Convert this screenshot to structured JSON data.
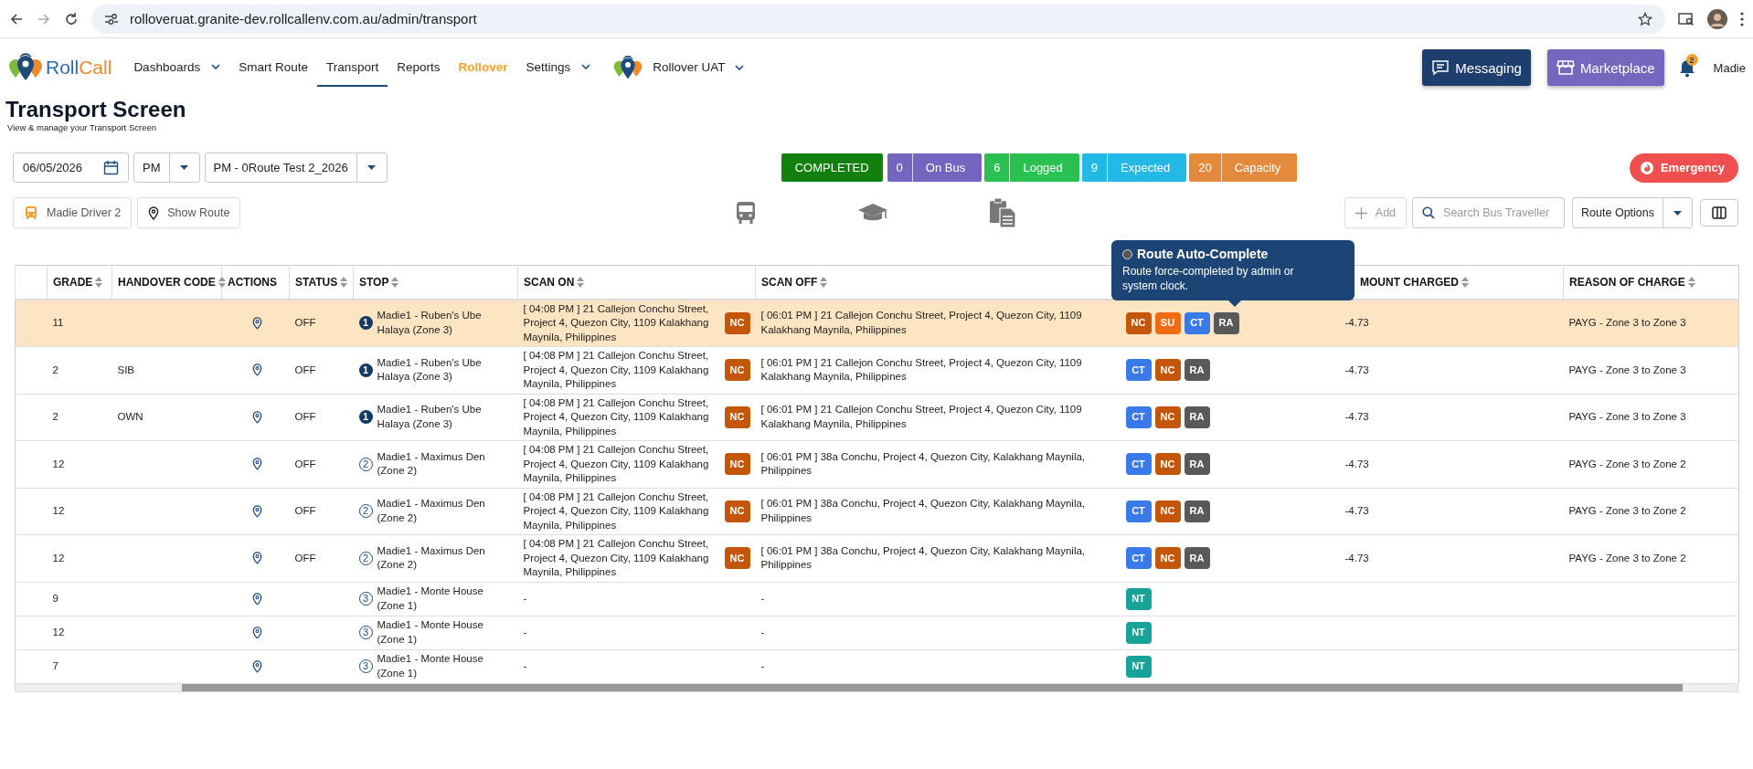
{
  "browser": {
    "url": "rolloveruat.granite-dev.rollcallenv.com.au/admin/transport"
  },
  "nav": {
    "logo": {
      "first": "Roll",
      "second": "Call"
    },
    "items": [
      {
        "label": "Dashboards",
        "menu": true,
        "selected": false,
        "emphasized": false
      },
      {
        "label": "Smart Route",
        "menu": false,
        "selected": false,
        "emphasized": false
      },
      {
        "label": "Transport",
        "menu": false,
        "selected": true,
        "emphasized": false
      },
      {
        "label": "Reports",
        "menu": false,
        "selected": false,
        "emphasized": false
      },
      {
        "label": "Rollover",
        "menu": false,
        "selected": false,
        "emphasized": true
      },
      {
        "label": "Settings",
        "menu": true,
        "selected": false,
        "emphasized": false
      }
    ],
    "org": "Rollover UAT",
    "messaging": "Messaging",
    "marketplace": "Marketplace",
    "notifications": "2",
    "user": "Madie"
  },
  "page": {
    "title": "Transport Screen",
    "subtitle": "View & manage your Transport Screen"
  },
  "filters": {
    "date": "06/05/2026",
    "period": "PM",
    "route": "PM - 0Route Test 2_2026"
  },
  "status_summary": {
    "state": "COMPLETED",
    "counters": [
      {
        "count": "0",
        "label": "On Bus",
        "color": "#7466c0"
      },
      {
        "count": "6",
        "label": "Logged",
        "color": "#2ac152"
      },
      {
        "count": "9",
        "label": "Expected",
        "color": "#24b8e6"
      },
      {
        "count": "20",
        "label": "Capacity",
        "color": "#e48a3c"
      }
    ]
  },
  "emergency": "Emergency",
  "toolbar": {
    "driver": "Madie Driver 2",
    "show_route": "Show Route",
    "add": "Add",
    "add_disabled": true,
    "search_placeholder": "Search Bus Traveller",
    "route_options": "Route Options"
  },
  "table": {
    "columns": [
      {
        "label": "GRADE",
        "sortable": true
      },
      {
        "label": "HANDOVER CODE",
        "sortable": true
      },
      {
        "label": "ACTIONS",
        "sortable": false
      },
      {
        "label": "STATUS",
        "sortable": true
      },
      {
        "label": "STOP",
        "sortable": true
      },
      {
        "label": "SCAN ON",
        "sortable": true
      },
      {
        "label": "SCAN OFF",
        "sortable": true
      },
      {
        "label": "MOUNT CHARGED",
        "sortable": true
      },
      {
        "label": "REASON OF CHARGE",
        "sortable": true
      }
    ],
    "rows": [
      {
        "selected": true,
        "grade": "11",
        "handover_code": "",
        "status": "OFF",
        "stop": {
          "number": "1",
          "name": "Madie1 - Ruben's Ube Halaya (Zone 3)",
          "filled": true
        },
        "scan_on": {
          "text": "[ 04:08 PM ] 21 Callejon Conchu Street, Project 4, Quezon City, 1109 Kalakhang Maynila, Philippines",
          "badge": {
            "code": "NC",
            "color": "#c4560a"
          }
        },
        "scan_off": "[ 06:01 PM ] 21 Callejon Conchu Street, Project 4, Quezon City, 1109 Kalakhang Maynila, Philippines",
        "tags": [
          {
            "code": "NC",
            "color": "#c4560a"
          },
          {
            "code": "SU",
            "color": "#f26b12"
          },
          {
            "code": "CT",
            "color": "#3a7ae8"
          },
          {
            "code": "RA",
            "color": "#595959"
          }
        ],
        "amount": "-4.73",
        "reason": "PAYG - Zone 3 to Zone 3"
      },
      {
        "selected": false,
        "grade": "2",
        "handover_code": "SIB",
        "status": "OFF",
        "stop": {
          "number": "1",
          "name": "Madie1 - Ruben's Ube Halaya (Zone 3)",
          "filled": true
        },
        "scan_on": {
          "text": "[ 04:08 PM ] 21 Callejon Conchu Street, Project 4, Quezon City, 1109 Kalakhang Maynila, Philippines",
          "badge": {
            "code": "NC",
            "color": "#c4560a"
          }
        },
        "scan_off": "[ 06:01 PM ] 21 Callejon Conchu Street, Project 4, Quezon City, 1109 Kalakhang Maynila, Philippines",
        "tags": [
          {
            "code": "CT",
            "color": "#3a7ae8"
          },
          {
            "code": "NC",
            "color": "#c4560a"
          },
          {
            "code": "RA",
            "color": "#595959"
          }
        ],
        "amount": "-4.73",
        "reason": "PAYG - Zone 3 to Zone 3"
      },
      {
        "selected": false,
        "grade": "2",
        "handover_code": "OWN",
        "status": "OFF",
        "stop": {
          "number": "1",
          "name": "Madie1 - Ruben's Ube Halaya (Zone 3)",
          "filled": true
        },
        "scan_on": {
          "text": "[ 04:08 PM ] 21 Callejon Conchu Street, Project 4, Quezon City, 1109 Kalakhang Maynila, Philippines",
          "badge": {
            "code": "NC",
            "color": "#c4560a"
          }
        },
        "scan_off": "[ 06:01 PM ] 21 Callejon Conchu Street, Project 4, Quezon City, 1109 Kalakhang Maynila, Philippines",
        "tags": [
          {
            "code": "CT",
            "color": "#3a7ae8"
          },
          {
            "code": "NC",
            "color": "#c4560a"
          },
          {
            "code": "RA",
            "color": "#595959"
          }
        ],
        "amount": "-4.73",
        "reason": "PAYG - Zone 3 to Zone 3"
      },
      {
        "selected": false,
        "grade": "12",
        "handover_code": "",
        "status": "OFF",
        "stop": {
          "number": "2",
          "name": "Madie1 - Maximus Den (Zone 2)",
          "filled": false
        },
        "scan_on": {
          "text": "[ 04:08 PM ] 21 Callejon Conchu Street, Project 4, Quezon City, 1109 Kalakhang Maynila, Philippines",
          "badge": {
            "code": "NC",
            "color": "#c4560a"
          }
        },
        "scan_off": "[ 06:01 PM ] 38a Conchu, Project 4, Quezon City, Kalakhang Maynila, Philippines",
        "tags": [
          {
            "code": "CT",
            "color": "#3a7ae8"
          },
          {
            "code": "NC",
            "color": "#c4560a"
          },
          {
            "code": "RA",
            "color": "#595959"
          }
        ],
        "amount": "-4.73",
        "reason": "PAYG - Zone 3 to Zone 2"
      },
      {
        "selected": false,
        "grade": "12",
        "handover_code": "",
        "status": "OFF",
        "stop": {
          "number": "2",
          "name": "Madie1 - Maximus Den (Zone 2)",
          "filled": false
        },
        "scan_on": {
          "text": "[ 04:08 PM ] 21 Callejon Conchu Street, Project 4, Quezon City, 1109 Kalakhang Maynila, Philippines",
          "badge": {
            "code": "NC",
            "color": "#c4560a"
          }
        },
        "scan_off": "[ 06:01 PM ] 38a Conchu, Project 4, Quezon City, Kalakhang Maynila, Philippines",
        "tags": [
          {
            "code": "CT",
            "color": "#3a7ae8"
          },
          {
            "code": "NC",
            "color": "#c4560a"
          },
          {
            "code": "RA",
            "color": "#595959"
          }
        ],
        "amount": "-4.73",
        "reason": "PAYG - Zone 3 to Zone 2"
      },
      {
        "selected": false,
        "grade": "12",
        "handover_code": "",
        "status": "OFF",
        "stop": {
          "number": "2",
          "name": "Madie1 - Maximus Den (Zone 2)",
          "filled": false
        },
        "scan_on": {
          "text": "[ 04:08 PM ] 21 Callejon Conchu Street, Project 4, Quezon City, 1109 Kalakhang Maynila, Philippines",
          "badge": {
            "code": "NC",
            "color": "#c4560a"
          }
        },
        "scan_off": "[ 06:01 PM ] 38a Conchu, Project 4, Quezon City, Kalakhang Maynila, Philippines",
        "tags": [
          {
            "code": "CT",
            "color": "#3a7ae8"
          },
          {
            "code": "NC",
            "color": "#c4560a"
          },
          {
            "code": "RA",
            "color": "#595959"
          }
        ],
        "amount": "-4.73",
        "reason": "PAYG - Zone 3 to Zone 2"
      },
      {
        "selected": false,
        "grade": "9",
        "handover_code": "",
        "status": "",
        "stop": {
          "number": "3",
          "name": "Madie1 - Monte House (Zone 1)",
          "filled": false
        },
        "scan_on": {
          "text": "-"
        },
        "scan_off": "-",
        "tags": [
          {
            "code": "NT",
            "color": "#17a398"
          }
        ],
        "amount": "",
        "reason": ""
      },
      {
        "selected": false,
        "grade": "12",
        "handover_code": "",
        "status": "",
        "stop": {
          "number": "3",
          "name": "Madie1 - Monte House (Zone 1)",
          "filled": false
        },
        "scan_on": {
          "text": "-"
        },
        "scan_off": "-",
        "tags": [
          {
            "code": "NT",
            "color": "#17a398"
          }
        ],
        "amount": "",
        "reason": ""
      },
      {
        "selected": false,
        "grade": "7",
        "handover_code": "",
        "status": "",
        "stop": {
          "number": "3",
          "name": "Madie1 - Monte House (Zone 1)",
          "filled": false
        },
        "scan_on": {
          "text": "-"
        },
        "scan_off": "-",
        "tags": [
          {
            "code": "NT",
            "color": "#17a398"
          }
        ],
        "amount": "",
        "reason": ""
      }
    ]
  },
  "tooltip": {
    "title": "Route Auto-Complete",
    "body": "Route force-completed by admin or system clock."
  }
}
